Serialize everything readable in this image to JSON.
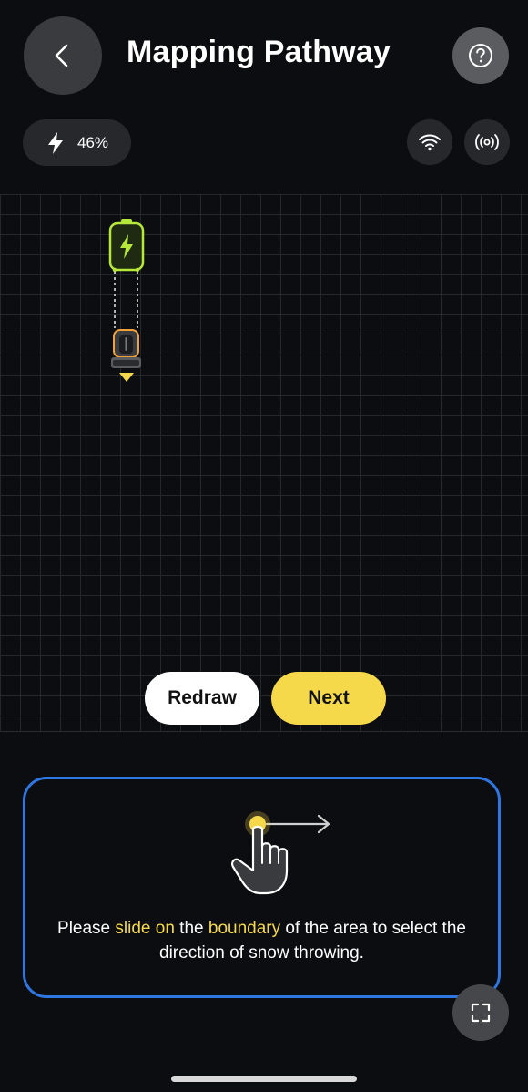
{
  "header": {
    "title": "Mapping Pathway",
    "back_icon": "chevron-left-icon",
    "help_icon": "help-circle-icon"
  },
  "status": {
    "battery_percent": "46%",
    "battery_icon": "lightning-icon",
    "wifi_icon": "wifi-icon",
    "signal_icon": "broadcast-icon"
  },
  "map": {
    "charging_station_icon": "charging-station-icon",
    "robot_icon": "snow-robot-icon",
    "heading_marker": "direction-triangle-icon",
    "colors": {
      "station_green": "#b5e83a",
      "accent_yellow": "#f6d94b",
      "robot_orange": "#f0a23a"
    }
  },
  "actions": {
    "redraw_label": "Redraw",
    "next_label": "Next"
  },
  "hint": {
    "text_1": "Please ",
    "highlight_1": "slide on",
    "text_2": " the ",
    "highlight_2": "boundary",
    "text_3": " of the area to select the direction of snow throwing.",
    "illustration_icon": "hand-swipe-icon"
  },
  "fullscreen_icon": "fullscreen-icon",
  "theme": {
    "background": "#0c0d10",
    "card_border": "#2f76e0",
    "accent": "#f6d94b"
  }
}
